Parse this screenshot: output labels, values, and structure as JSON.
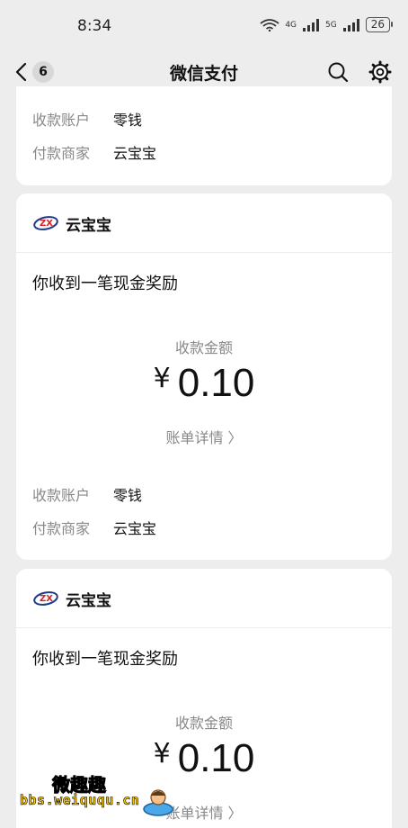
{
  "status_bar": {
    "time": "8:34",
    "net_4g": "4G",
    "net_5g": "5G",
    "battery": "26"
  },
  "nav": {
    "unread_count": "6",
    "title": "微信支付"
  },
  "partial_card": {
    "rows": [
      {
        "label": "收款账户",
        "value": "零钱"
      },
      {
        "label": "付款商家",
        "value": "云宝宝"
      }
    ]
  },
  "cards": [
    {
      "merchant": "云宝宝",
      "headline": "你收到一笔现金奖励",
      "amount_label": "收款金额",
      "currency": "¥",
      "amount": "0.10",
      "bill_link": "账单详情 〉",
      "rows": [
        {
          "label": "收款账户",
          "value": "零钱"
        },
        {
          "label": "付款商家",
          "value": "云宝宝"
        }
      ]
    },
    {
      "merchant": "云宝宝",
      "headline": "你收到一笔现金奖励",
      "amount_label": "收款金额",
      "currency": "¥",
      "amount": "0.10",
      "bill_link": "账单详情 〉"
    }
  ],
  "watermark": {
    "line1": "微趣趣",
    "line2": "bbs.weiququ.cn"
  },
  "colors": {
    "background": "#ededed",
    "card": "#ffffff",
    "muted_text": "#888888",
    "logo_red": "#d3222a",
    "logo_blue": "#1f3a8a"
  }
}
